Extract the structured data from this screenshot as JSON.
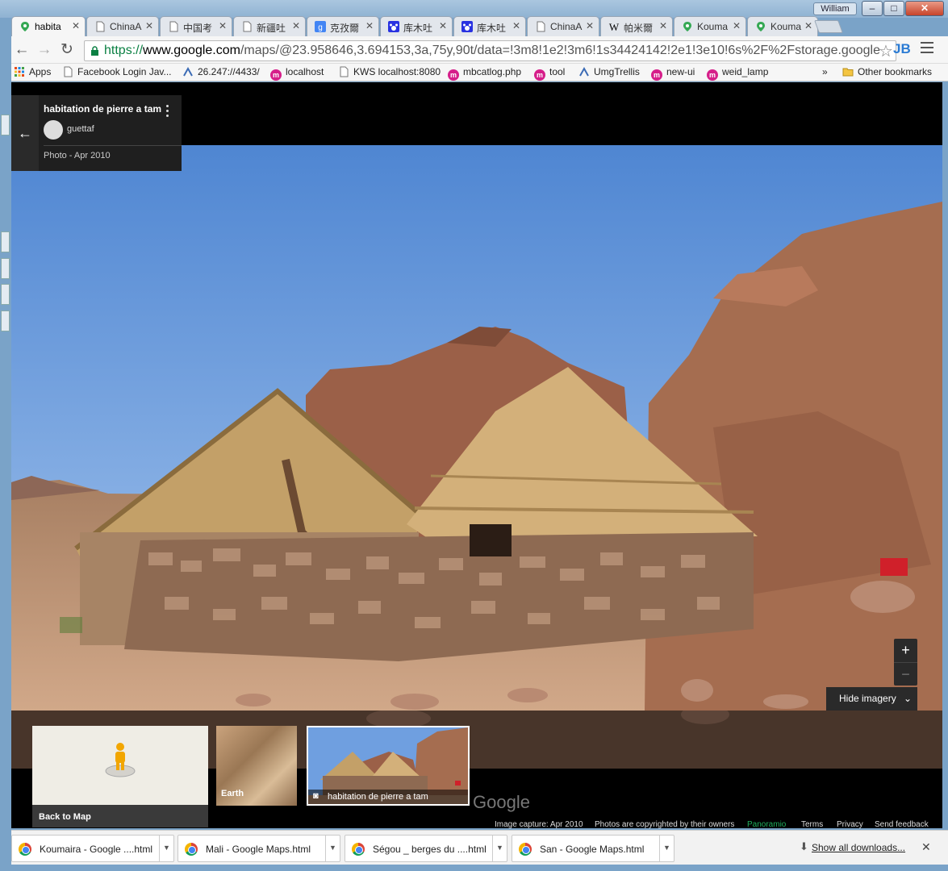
{
  "window": {
    "user": "William",
    "controls": [
      "–",
      "□",
      "✕"
    ]
  },
  "tabs": [
    {
      "label": "habita",
      "icon": "google-maps-icon",
      "active": true
    },
    {
      "label": "ChinaA",
      "icon": "page-icon"
    },
    {
      "label": "中国考",
      "icon": "page-icon"
    },
    {
      "label": "新疆吐",
      "icon": "page-icon"
    },
    {
      "label": "克孜爾",
      "icon": "google-g-icon"
    },
    {
      "label": "库木吐",
      "icon": "paw-icon"
    },
    {
      "label": "库木吐",
      "icon": "paw-icon"
    },
    {
      "label": "ChinaA",
      "icon": "page-icon"
    },
    {
      "label": "帕米爾",
      "icon": "wikipedia-icon"
    },
    {
      "label": "Kouma",
      "icon": "google-maps-icon"
    },
    {
      "label": "Kouma",
      "icon": "google-maps-icon"
    }
  ],
  "address": {
    "scheme": "https://",
    "host": "www.google.com",
    "path": "/maps/@23.958646,3.694153,3a,75y,90t/data=!3m8!1e2!3m6!1s34424142!2e1!3e10!6s%2F%2Fstorage.google"
  },
  "extension_label": "JB",
  "bookmarks": [
    {
      "label": "Apps",
      "icon": "apps-grid-icon"
    },
    {
      "label": "Facebook Login Jav...",
      "icon": "page-icon"
    },
    {
      "label": "26.247://4433/",
      "icon": "trellis-icon"
    },
    {
      "label": "localhost",
      "icon": "m-circle-icon"
    },
    {
      "label": "KWS localhost:8080",
      "icon": "page-icon"
    },
    {
      "label": "mbcatlog.php",
      "icon": "m-circle-icon"
    },
    {
      "label": "tool",
      "icon": "m-circle-icon"
    },
    {
      "label": "UmgTrellis",
      "icon": "trellis-icon"
    },
    {
      "label": "new-ui",
      "icon": "m-circle-icon"
    },
    {
      "label": "weid_lamp",
      "icon": "m-circle-icon"
    }
  ],
  "bookmarks_overflow": "»",
  "other_bookmarks": "Other bookmarks",
  "photo_card": {
    "title": "habitation de pierre a tam",
    "author": "guettaf",
    "date": "Photo - Apr 2010"
  },
  "controls": {
    "zoom_in": "+",
    "zoom_out": "−",
    "hide_imagery": "Hide imagery"
  },
  "filmstrip": {
    "back_to_map": "Back to Map",
    "earth": "Earth",
    "selected_photo": "habitation de pierre a tam",
    "google_logo": "Google"
  },
  "footer": {
    "capture": "Image capture: Apr 2010",
    "copyright": "Photos are copyrighted by their owners",
    "panoramio": "Panoramio",
    "terms": "Terms",
    "privacy": "Privacy",
    "feedback": "Send feedback"
  },
  "downloads": [
    {
      "label": "Koumaira - Google ....html"
    },
    {
      "label": "Mali - Google Maps.html"
    },
    {
      "label": "Ségou _ berges du ....html"
    },
    {
      "label": "San - Google Maps.html"
    }
  ],
  "show_all_downloads": "Show all downloads...",
  "colors": {
    "sky": "#6f9fe0",
    "rock": "#a86e4f",
    "ground": "#c79a78",
    "accent_green": "#0b8043"
  }
}
